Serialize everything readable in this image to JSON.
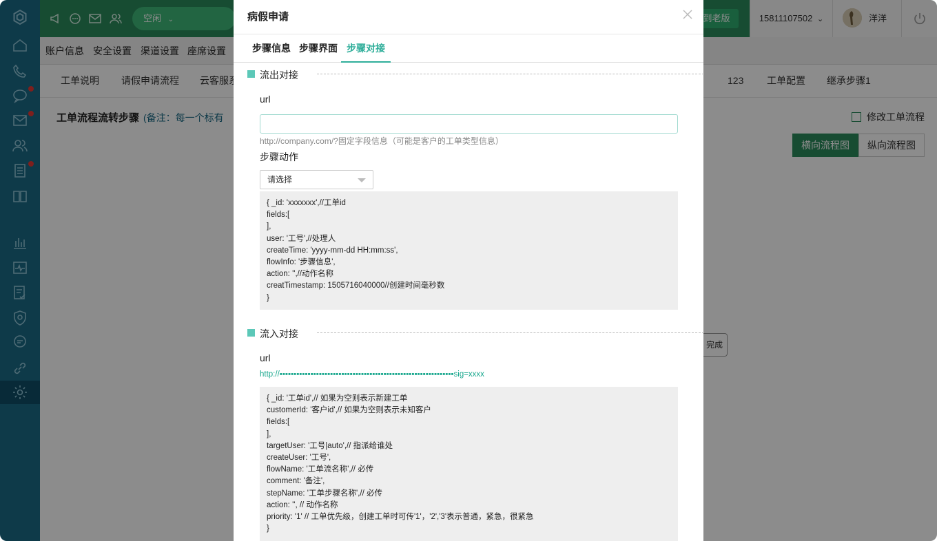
{
  "app": {
    "status_label": "空闲",
    "back_old_label": "到老版",
    "phone": "15811107502",
    "user_name": "洋洋"
  },
  "menu": [
    "账户信息",
    "安全设置",
    "渠道设置",
    "座席设置"
  ],
  "page_tabs": [
    "工单说明",
    "请假申请流程",
    "云客服系",
    "123",
    "工单配置",
    "继承步骤1"
  ],
  "page": {
    "title": "工单流程流转步骤",
    "note": "(备注：每一个标有",
    "edit_label": "修改工单流程",
    "horizontal_label": "横向流程图",
    "vertical_label": "纵向流程图",
    "done_label": "完成"
  },
  "modal": {
    "title": "病假申请",
    "tabs": [
      "步骤信息",
      "步骤界面",
      "步骤对接"
    ],
    "active_tab": 2,
    "outflow": {
      "title": "流出对接",
      "url_label": "url",
      "url_value": "",
      "url_hint": "http://company.com/?固定字段信息（可能是客户的工单类型信息）",
      "action_label": "步骤动作",
      "action_placeholder": "请选择",
      "code": "{ _id: 'xxxxxxx',//工单id\nfields:[\n],\nuser: '工号',//处理人\ncreateTime: 'yyyy-mm-dd HH:mm:ss',\nflowInfo: '步骤信息',\naction: '',//动作名称\ncreatTimestamp: 1505716040000//创建时间毫秒数\n}"
    },
    "inflow": {
      "title": "流入对接",
      "url_label": "url",
      "url_value": "http://▪▪▪▪▪▪▪▪▪▪▪▪▪▪▪▪▪▪▪▪▪▪▪▪▪▪▪▪▪▪▪▪▪▪▪▪▪▪▪▪▪▪▪▪▪▪▪▪▪▪▪▪▪▪▪▪▪▪▪▪▪▪sig=xxxx",
      "code": "{ _id: '工单id',// 如果为空则表示新建工单\ncustomerId: '客户id',// 如果为空则表示未知客户\nfields:[\n],\ntargetUser: '工号|auto',// 指派给谁处\ncreateUser: '工号',\nflowName: '工单流名称',// 必传\ncomment: '备注',\nstepName: '工单步骤名称',// 必传\naction: '', // 动作名称\npriority: '1' // 工单优先级，创建工单时可传'1'，'2','3'表示普通，紧急，很紧急\n}"
    }
  }
}
